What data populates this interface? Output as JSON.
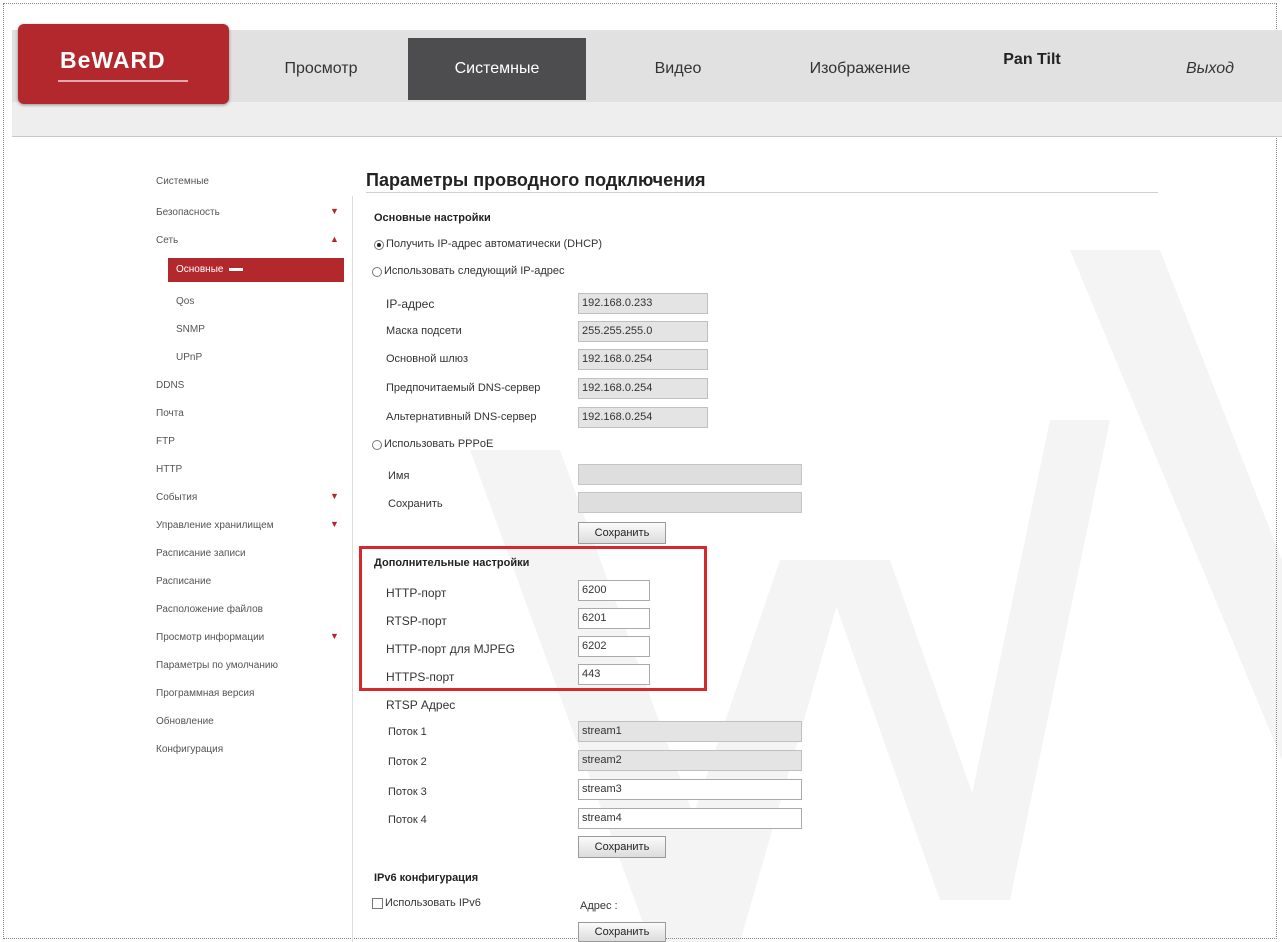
{
  "header": {
    "logo": "BeWARD",
    "tabs": [
      {
        "label": "Просмотр",
        "active": false
      },
      {
        "label": "Системные",
        "active": true
      },
      {
        "label": "Видео",
        "active": false
      },
      {
        "label": "Изображение",
        "active": false
      },
      {
        "label": "Pan Tilt",
        "active": false
      },
      {
        "label": "Выход",
        "active": false
      }
    ]
  },
  "sidebar": {
    "items": [
      {
        "label": "Системные"
      },
      {
        "label": "Безопасность",
        "arrow": "▼"
      },
      {
        "label": "Сеть",
        "arrow": "▲"
      },
      {
        "label": "Основные",
        "active": true
      },
      {
        "label": "Qos"
      },
      {
        "label": "SNMP"
      },
      {
        "label": "UPnP"
      },
      {
        "label": "DDNS"
      },
      {
        "label": "Почта"
      },
      {
        "label": "FTP"
      },
      {
        "label": "HTTP"
      },
      {
        "label": "События",
        "arrow": "▼"
      },
      {
        "label": "Управление хранилищем",
        "arrow": "▼"
      },
      {
        "label": "Расписание записи"
      },
      {
        "label": "Расписание"
      },
      {
        "label": "Расположение файлов"
      },
      {
        "label": "Просмотр информации",
        "arrow": "▼"
      },
      {
        "label": "Параметры по умолчанию"
      },
      {
        "label": "Программная версия"
      },
      {
        "label": "Обновление"
      },
      {
        "label": "Конфигурация"
      }
    ]
  },
  "main": {
    "title": "Параметры проводного подключения",
    "basic": {
      "heading": "Основные настройки",
      "dhcp_label": "Получить IP-адрес автоматически (DHCP)",
      "static_label": "Использовать следующий IP-адрес",
      "fields": [
        {
          "label": "IP-адрес",
          "value": "192.168.0.233"
        },
        {
          "label": "Маска подсети",
          "value": "255.255.255.0"
        },
        {
          "label": "Основной шлюз",
          "value": "192.168.0.254"
        },
        {
          "label": "Предпочитаемый DNS-сервер",
          "value": "192.168.0.254"
        },
        {
          "label": "Альтернативный DNS-сервер",
          "value": "192.168.0.254"
        }
      ],
      "pppoe_label": "Использовать PPPoE",
      "pppoe_fields": [
        {
          "label": "Имя",
          "value": ""
        },
        {
          "label": "Сохранить",
          "value": ""
        }
      ],
      "save_label": "Сохранить"
    },
    "advanced": {
      "heading": "Дополнительные настройки",
      "ports": [
        {
          "label": "HTTP-порт",
          "value": "6200"
        },
        {
          "label": "RTSP-порт",
          "value": "6201"
        },
        {
          "label": "HTTP-порт для MJPEG",
          "value": "6202"
        },
        {
          "label": "HTTPS-порт",
          "value": "443"
        }
      ],
      "rtsp_heading": "RTSP Адрес",
      "streams": [
        {
          "label": "Поток 1",
          "value": "stream1"
        },
        {
          "label": "Поток 2",
          "value": "stream2"
        },
        {
          "label": "Поток 3",
          "value": "stream3"
        },
        {
          "label": "Поток 4",
          "value": "stream4"
        }
      ],
      "save_label": "Сохранить"
    },
    "ipv6": {
      "heading": "IPv6 конфигурация",
      "use_label": "Использовать IPv6",
      "address_label": "Адрес :",
      "save_label": "Сохранить"
    }
  },
  "colors": {
    "brand": "#b3282d",
    "active_tab": "#4d4d4f",
    "highlight": "#d7282e"
  }
}
